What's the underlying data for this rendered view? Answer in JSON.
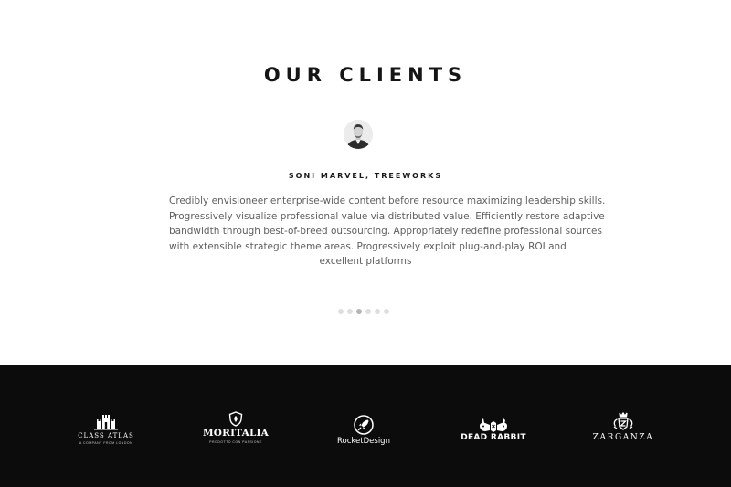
{
  "section": {
    "title": "OUR CLIENTS"
  },
  "testimonial": {
    "author": "SONI MARVEL, TREEWORKS",
    "quote_lines": [
      "Credibly envisioneer enterprise-wide content before resource maximizing leadership skills.",
      "Progressively visualize professional value via distributed value. Efficiently restore adaptive",
      "bandwidth through best-of-breed outsourcing. Appropriately redefine professional sources",
      "with extensible strategic theme areas. Progressively exploit plug-and-play ROI and",
      "excellent platforms"
    ]
  },
  "carousel": {
    "total_slides": 6,
    "active_index": 2
  },
  "clients": [
    {
      "name": "CLASS ATLAS",
      "tagline": "A COMPANY FROM LONDON",
      "icon": "castle-icon"
    },
    {
      "name": "MORITALIA",
      "tagline": "PRODOTTO CON PASSIONE",
      "icon": "shield-icon"
    },
    {
      "name": "RocketDesign",
      "icon": "rocket-icon"
    },
    {
      "name": "DEAD RABBIT",
      "icon": "rabbit-icon"
    },
    {
      "name": "ZARGANZA",
      "icon": "crest-icon"
    }
  ],
  "colors": {
    "background": "#ffffff",
    "heading": "#151515",
    "body_text": "#5e5e5e",
    "band": "#0c0c0c",
    "dot": "#dedede",
    "dot_active": "#b5b5b5"
  }
}
